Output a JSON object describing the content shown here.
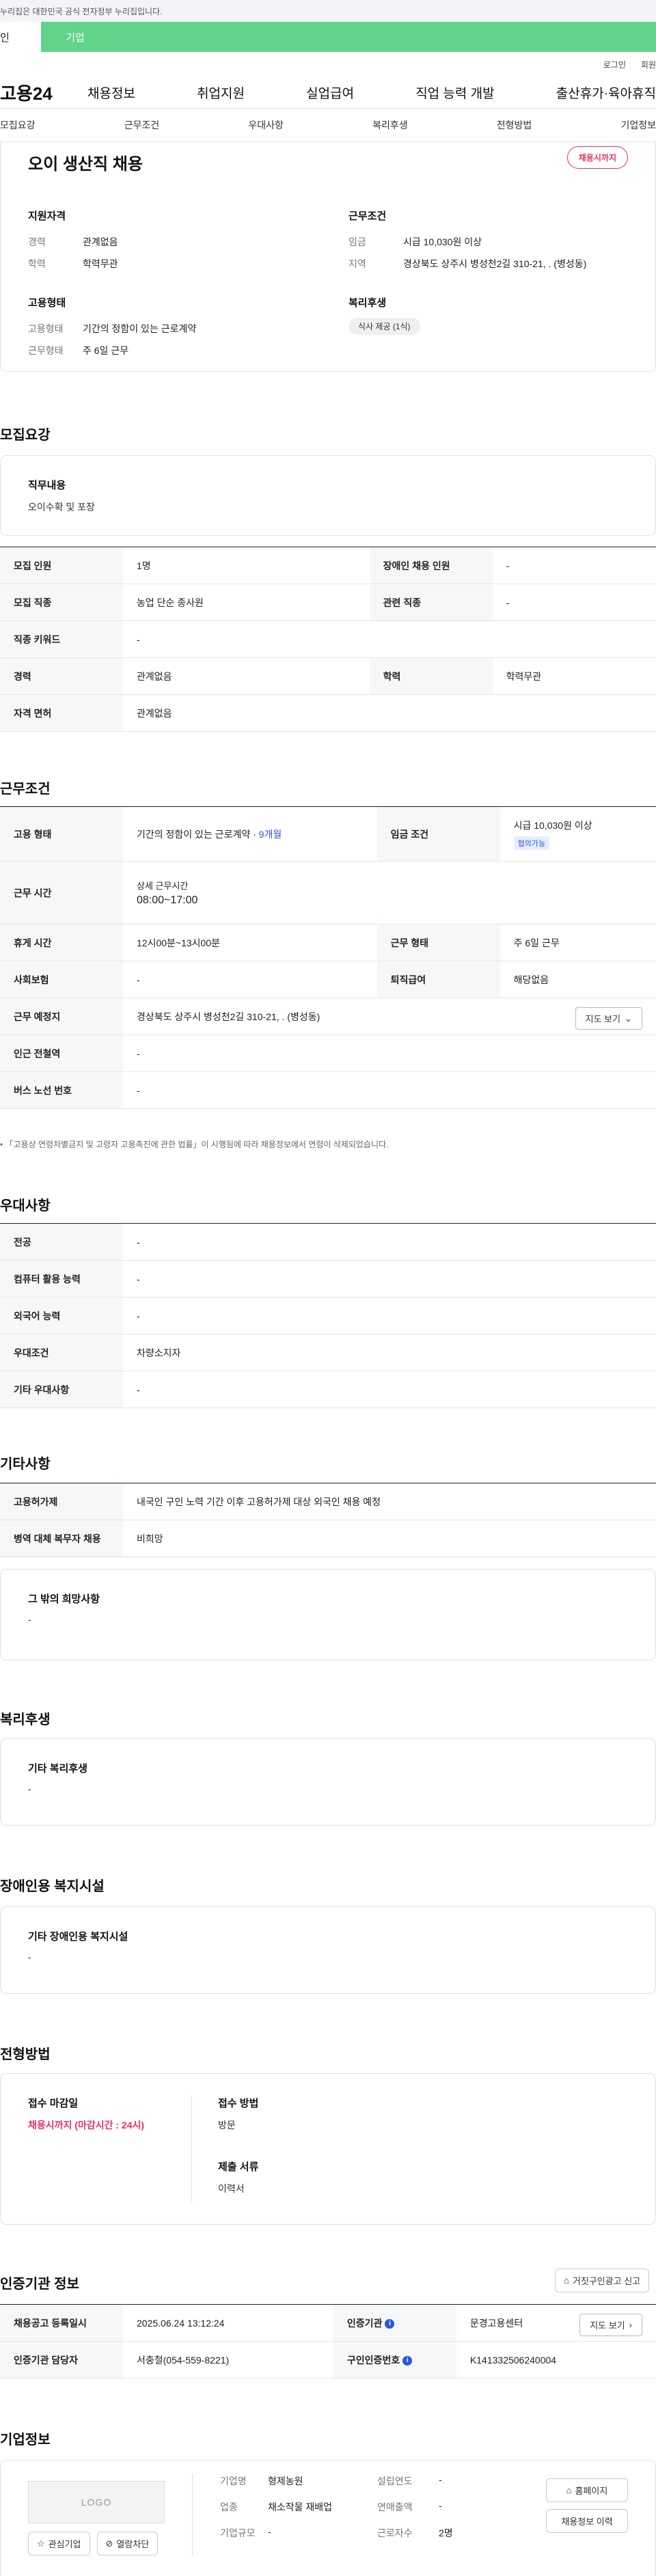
{
  "notice": "누리집은 대한민국 공식 전자정부 누리집입니다.",
  "gnb_tabs": [
    "인",
    "기업"
  ],
  "util": {
    "login": "로그인",
    "join": "회원"
  },
  "logo": "고용24",
  "menu": [
    "채용정보",
    "취업지원",
    "실업급여",
    "직업 능력 개발",
    "출산휴가·육아휴직"
  ],
  "subnav": [
    "모집요강",
    "근무조건",
    "우대사항",
    "복리후생",
    "전형방법",
    "기업정보"
  ],
  "summary": {
    "title": "오이 생산직 채용",
    "badge": "채용시까지",
    "qual_title": "지원자격",
    "qual": [
      {
        "k": "경력",
        "v": "관계없음"
      },
      {
        "k": "학력",
        "v": "학력무관"
      }
    ],
    "cond_title": "근무조건",
    "cond": [
      {
        "k": "임금",
        "v": "시급 10,030원 이상"
      },
      {
        "k": "지역",
        "v": "경상북도 상주시 병성천2길 310-21, . (병성동)"
      }
    ],
    "type_title": "고용형태",
    "type": [
      {
        "k": "고용형태",
        "v": "기간의 정함이 있는 근로계약"
      },
      {
        "k": "근무형태",
        "v": "주 6일 근무"
      }
    ],
    "welfare_title": "복리후생",
    "welfare_chip": "식사 제공 (1식)"
  },
  "recruit": {
    "title": "모집요강",
    "duty_label": "직무내용",
    "duty_value": "오이수확 및 포장",
    "rows": [
      [
        "모집 인원",
        "1명",
        "장애인 채용 인원",
        "-"
      ],
      [
        "모집 직종",
        "농업 단순 종사원",
        "관련 직종",
        "-"
      ],
      [
        "직종 키워드",
        "-"
      ],
      [
        "경력",
        "관계없음",
        "학력",
        "학력무관"
      ],
      [
        "자격 면허",
        "관계없음"
      ]
    ]
  },
  "work": {
    "title": "근무조건",
    "emp_type_label": "고용 형태",
    "emp_type_value": "기간의 정함이 있는 근로계약 · ",
    "emp_type_period": "9개월",
    "wage_label": "임금 조건",
    "wage_value": "시급 10,030원 이상",
    "wage_badge": "협의가능",
    "hours_label": "근무 시간",
    "hours_sub": "상세 근무시간",
    "hours_value": "08:00~17:00",
    "rows": [
      [
        "휴게 시간",
        "12시00분~13시00분",
        "근무 형태",
        "주 6일 근무"
      ],
      [
        "사회보험",
        "-",
        "퇴직급여",
        "해당없음"
      ]
    ],
    "place_label": "근무 예정지",
    "place_value": "경상북도 상주시 병성천2길 310-21, . (병성동)",
    "map_btn": "지도 보기",
    "station_label": "인근 전철역",
    "station_value": "-",
    "bus_label": "버스 노선 번호",
    "bus_value": "-",
    "footnote": "「고용상 연령차별금지 및 고령자 고용촉진에 관한 법률」이 시행됨에 따라 채용정보에서 연령이 삭제되었습니다."
  },
  "pref": {
    "title": "우대사항",
    "rows": [
      [
        "전공",
        "-"
      ],
      [
        "컴퓨터 활용 능력",
        "-"
      ],
      [
        "외국어 능력",
        "-"
      ],
      [
        "우대조건",
        "차량소지자"
      ],
      [
        "기타 우대사항",
        "-"
      ]
    ]
  },
  "etc": {
    "title": "기타사항",
    "rows": [
      [
        "고용허가제",
        "내국인 구인 노력 기간 이후 고용허가제 대상 외국인 채용 예정"
      ],
      [
        "병역 대체 복무자 채용",
        "비희망"
      ]
    ],
    "other_label": "그 밖의 희망사항",
    "other_value": "-"
  },
  "welfare": {
    "title": "복리후생",
    "label": "기타 복리후생",
    "value": "-"
  },
  "disabled": {
    "title": "장애인용 복지시설",
    "label": "기타 장애인용 복지시설",
    "value": "-"
  },
  "process": {
    "title": "전형방법",
    "deadline_label": "접수 마감일",
    "deadline_value": "채용시까지 (마감시간 : 24시)",
    "method_label": "접수 방법",
    "method_value": "방문",
    "docs_label": "제출 서류",
    "docs_value": "이력서"
  },
  "cert": {
    "title": "인증기관 정보",
    "report_btn": "거짓구인광고 신고",
    "reg_label": "채용공고 등록일시",
    "reg_value": "2025.06.24 13:12:24",
    "org_label": "인증기관",
    "org_value": "문경고용센터",
    "map_btn": "지도 보기",
    "mgr_label": "인증기관 담당자",
    "mgr_value": "서충철(054-559-8221)",
    "no_label": "구인인증번호",
    "no_value": "K141332506240004"
  },
  "company": {
    "title": "기업정보",
    "logo_text": "LOGO",
    "fav_btn": "관심기업",
    "block_btn": "열람차단",
    "rows": [
      [
        "기업명",
        "형제농원",
        "설립연도",
        "-"
      ],
      [
        "업종",
        "채소작물 재배업",
        "연매출액",
        "-"
      ],
      [
        "기업규모",
        "-",
        "근로자수",
        "2명"
      ]
    ],
    "home_btn": "홈페이지",
    "history_btn": "채용정보 이력"
  },
  "colors": {
    "brand_green": "#5fd48a",
    "pink": "#e8325f",
    "blue": "#2a56e0"
  }
}
